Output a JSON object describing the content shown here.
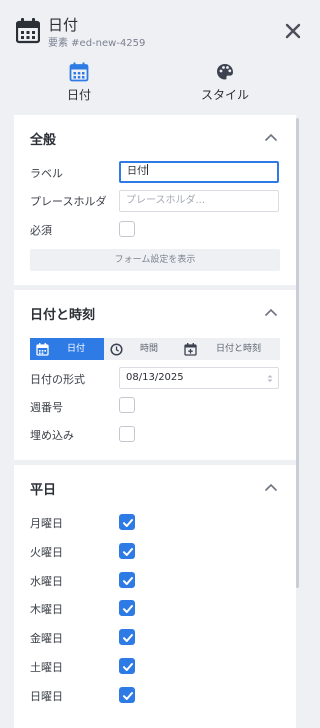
{
  "header": {
    "title": "日付",
    "subtitle": "要素 #ed-new-4259",
    "icon": "calendar-icon",
    "close_icon": "close-icon"
  },
  "tabs": [
    {
      "label": "日付",
      "icon": "calendar-icon",
      "active": true
    },
    {
      "label": "スタイル",
      "icon": "palette-icon",
      "active": false
    }
  ],
  "general": {
    "title": "全般",
    "label_label": "ラベル",
    "label_value": "日付",
    "placeholder_label": "プレースホルダ",
    "placeholder_placeholder": "プレースホルダ...",
    "required_label": "必須",
    "required_checked": false,
    "form_settings_button": "フォーム設定を表示"
  },
  "datetime": {
    "title": "日付と時刻",
    "segments": [
      {
        "label": "日付",
        "icon": "calendar-icon",
        "active": true
      },
      {
        "label": "時間",
        "icon": "clock-icon",
        "active": false
      },
      {
        "label": "日付と時刻",
        "icon": "calendar-plus-icon",
        "active": false
      }
    ],
    "format_label": "日付の形式",
    "format_value": "08/13/2025",
    "week_number_label": "週番号",
    "week_number_checked": false,
    "embed_label": "埋め込み",
    "embed_checked": false
  },
  "weekdays": {
    "title": "平日",
    "days": [
      {
        "label": "月曜日",
        "checked": true
      },
      {
        "label": "火曜日",
        "checked": true
      },
      {
        "label": "水曜日",
        "checked": true
      },
      {
        "label": "木曜日",
        "checked": true
      },
      {
        "label": "金曜日",
        "checked": true
      },
      {
        "label": "土曜日",
        "checked": true
      },
      {
        "label": "日曜日",
        "checked": true
      }
    ]
  },
  "colors": {
    "accent": "#2f7be5",
    "panel_bg": "#eef0f4",
    "card_bg": "#ffffff"
  }
}
